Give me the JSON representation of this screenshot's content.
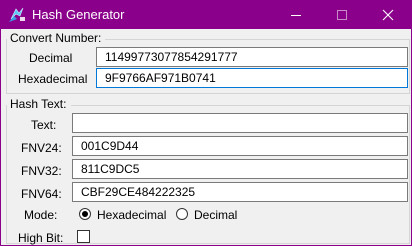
{
  "window": {
    "title": "Hash Generator",
    "accent_color": "#8b008b",
    "icons": {
      "app": "app-icon",
      "minimize": "minimize-icon",
      "maximize": "maximize-icon",
      "close": "close-icon"
    }
  },
  "convert_number": {
    "group_label": "Convert Number:",
    "decimal_label": "Decimal",
    "decimal_value": "11499773077854291777",
    "hex_label": "Hexadecimal",
    "hex_value": "9F9766AF971B0741"
  },
  "hash_text": {
    "group_label": "Hash Text:",
    "text_label": "Text:",
    "text_value": "",
    "fnv24_label": "FNV24:",
    "fnv24_value": "001C9D44",
    "fnv32_label": "FNV32:",
    "fnv32_value": "811C9DC5",
    "fnv64_label": "FNV64:",
    "fnv64_value": "CBF29CE484222325",
    "mode_label": "Mode:",
    "mode_options": [
      "Hexadecimal",
      "Decimal"
    ],
    "mode_selected": "Hexadecimal",
    "high_bit_label": "High Bit:",
    "high_bit_checked": false
  }
}
